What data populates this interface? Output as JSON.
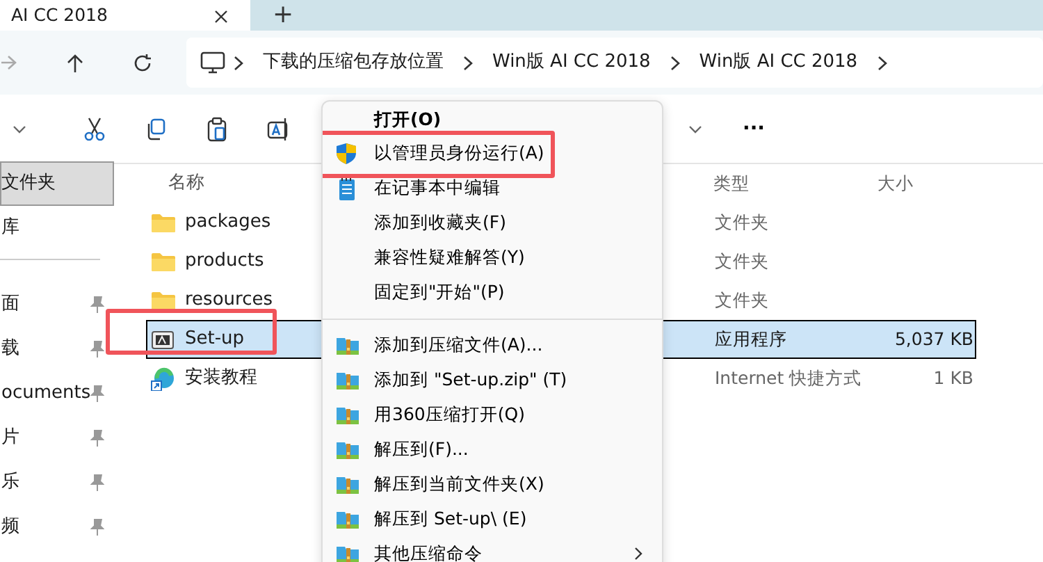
{
  "tabs": [
    {
      "title": "AI CC 2018",
      "selected": true
    }
  ],
  "new_tab": "+",
  "address_bar": {
    "segments": [
      "下载的压缩包存放位置",
      "Win版 AI CC 2018",
      "Win版 AI CC 2018"
    ]
  },
  "toolbar": {
    "more": "..."
  },
  "sidebar": {
    "items": [
      {
        "label": "文件夹",
        "selected": true,
        "pinned": false,
        "kind": "item"
      },
      {
        "label": "库",
        "selected": false,
        "pinned": false,
        "kind": "item"
      },
      {
        "kind": "divider"
      },
      {
        "label": "面",
        "selected": false,
        "pinned": true,
        "kind": "item"
      },
      {
        "label": "载",
        "selected": false,
        "pinned": true,
        "kind": "item"
      },
      {
        "label": "ocuments",
        "selected": false,
        "pinned": true,
        "kind": "item"
      },
      {
        "label": "片",
        "selected": false,
        "pinned": true,
        "kind": "item"
      },
      {
        "label": "乐",
        "selected": false,
        "pinned": true,
        "kind": "item"
      },
      {
        "label": "频",
        "selected": false,
        "pinned": true,
        "kind": "item"
      }
    ]
  },
  "table": {
    "columns": [
      "名称",
      "类型",
      "大小"
    ],
    "rows": [
      {
        "name": "packages",
        "type": "文件夹",
        "size": "",
        "kind": "folder",
        "selected": false,
        "highlighted": false
      },
      {
        "name": "products",
        "type": "文件夹",
        "size": "",
        "kind": "folder",
        "selected": false,
        "highlighted": false
      },
      {
        "name": "resources",
        "type": "文件夹",
        "size": "",
        "kind": "folder",
        "selected": false,
        "highlighted": false
      },
      {
        "name": "Set-up",
        "type": "应用程序",
        "size": "5,037 KB",
        "kind": "app",
        "selected": true,
        "highlighted": true
      },
      {
        "name": "安装教程",
        "type": "Internet 快捷方式",
        "size": "1 KB",
        "kind": "shortcut",
        "selected": false,
        "highlighted": false
      }
    ]
  },
  "context_menu": {
    "items": [
      {
        "label": "打开(O)",
        "kind": "default",
        "highlighted": false
      },
      {
        "label": "以管理员身份运行(A)",
        "kind": "admin",
        "highlighted": true
      },
      {
        "label": "在记事本中编辑",
        "kind": "notepad",
        "highlighted": false
      },
      {
        "label": "添加到收藏夹(F)",
        "kind": "plain",
        "highlighted": false
      },
      {
        "label": "兼容性疑难解答(Y)",
        "kind": "plain",
        "highlighted": false
      },
      {
        "label": "固定到\"开始\"(P)",
        "kind": "plain",
        "highlighted": false
      },
      {
        "kind": "separator"
      },
      {
        "label": "添加到压缩文件(A)...",
        "kind": "archive",
        "highlighted": false
      },
      {
        "label": "添加到 \"Set-up.zip\" (T)",
        "kind": "archive",
        "highlighted": false
      },
      {
        "label": "用360压缩打开(Q)",
        "kind": "archive",
        "highlighted": false
      },
      {
        "label": "解压到(F)...",
        "kind": "archive",
        "highlighted": false
      },
      {
        "label": "解压到当前文件夹(X)",
        "kind": "archive",
        "highlighted": false
      },
      {
        "label": "解压到 Set-up\\ (E)",
        "kind": "archive",
        "highlighted": false
      },
      {
        "label": "其他压缩命令",
        "kind": "submenu",
        "highlighted": false
      }
    ]
  }
}
